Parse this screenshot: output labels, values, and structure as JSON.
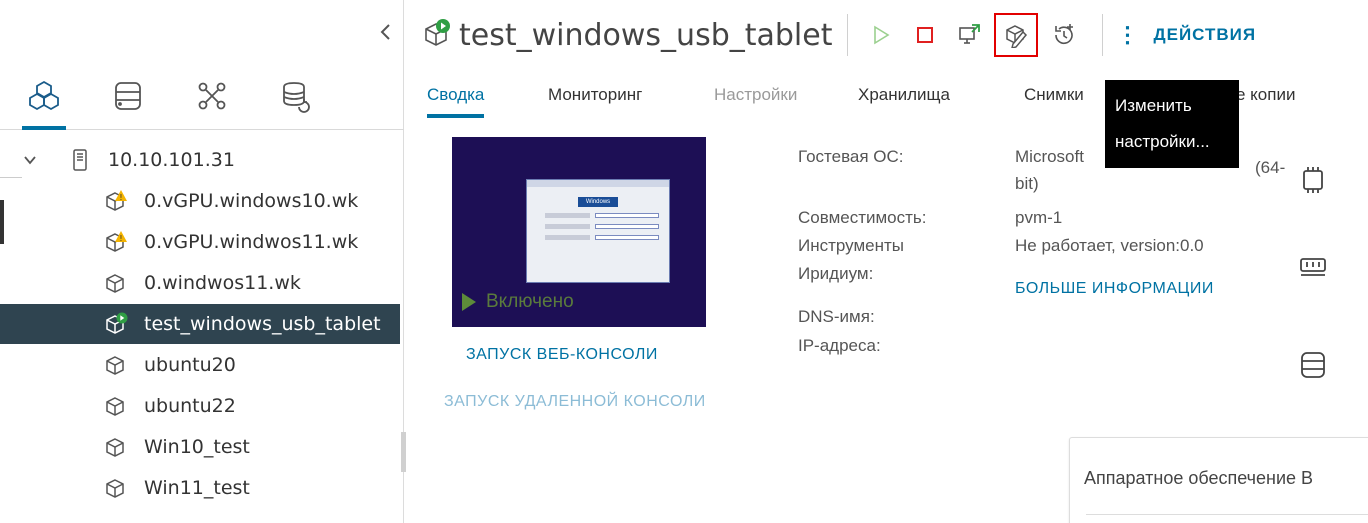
{
  "vm": {
    "name": "test_windows_usb_tablet",
    "power_state": "Включено"
  },
  "toolbar": {
    "power_on_label": "Power on",
    "power_off_label": "Power off",
    "console_label": "Launch console",
    "edit_settings_label": "Edit settings",
    "snapshot_label": "Snapshot",
    "actions_label": "ДЕЙСТВИЯ"
  },
  "tooltip": {
    "line1": "Изменить",
    "line2": "настройки..."
  },
  "tabs": [
    {
      "label": "Сводка",
      "state": "active"
    },
    {
      "label": "Мониторинг",
      "state": "normal"
    },
    {
      "label": "Настройки",
      "state": "disabled"
    },
    {
      "label": "Хранилища",
      "state": "normal"
    },
    {
      "label": "Снимки",
      "state": "normal"
    },
    {
      "label": "е копии",
      "state": "normal"
    }
  ],
  "inventory_tabs": [
    "vms-and-templates",
    "storage",
    "network",
    "datastore-clusters"
  ],
  "tree": {
    "host": "10.10.101.31",
    "vms": [
      {
        "name": "0.vGPU.windows10.wk",
        "status": "warning"
      },
      {
        "name": "0.vGPU.windwos11.wk",
        "status": "warning"
      },
      {
        "name": "0.windwos11.wk",
        "status": "off"
      },
      {
        "name": "test_windows_usb_tablet",
        "status": "running",
        "selected": true
      },
      {
        "name": "ubuntu20",
        "status": "off"
      },
      {
        "name": "ubuntu22",
        "status": "off"
      },
      {
        "name": "Win10_test",
        "status": "off"
      },
      {
        "name": "Win11_test",
        "status": "off"
      }
    ]
  },
  "console": {
    "web_console": "ЗАПУСК ВЕБ-КОНСОЛИ",
    "remote_console": "ЗАПУСК УДАЛЕННОЙ КОНСОЛИ",
    "screen_logo": "Windows"
  },
  "summary": {
    "guest_os_label": "Гостевая ОС:",
    "guest_os_value_1": "Microsoft",
    "guest_os_value_1b": "(64-",
    "guest_os_value_2": "bit)",
    "compat_label": "Совместимость:",
    "compat_value": "pvm-1",
    "tools_label": "Инструменты",
    "tools_value": "Не работает, version:0.0",
    "iridium_label": "Иридиум:",
    "more_info": "БОЛЬШЕ ИНФОРМАЦИИ",
    "dns_label": "DNS-имя:",
    "ip_label": "IP-адреса:"
  },
  "hardware": {
    "title": "Аппаратное обеспечение В"
  },
  "colors": {
    "accent": "#0072a3",
    "selected_row": "#2f4450",
    "tooltip_bg": "#000000",
    "highlight": "#e20000",
    "running": "#2f9e44",
    "warning": "#f4b400"
  }
}
